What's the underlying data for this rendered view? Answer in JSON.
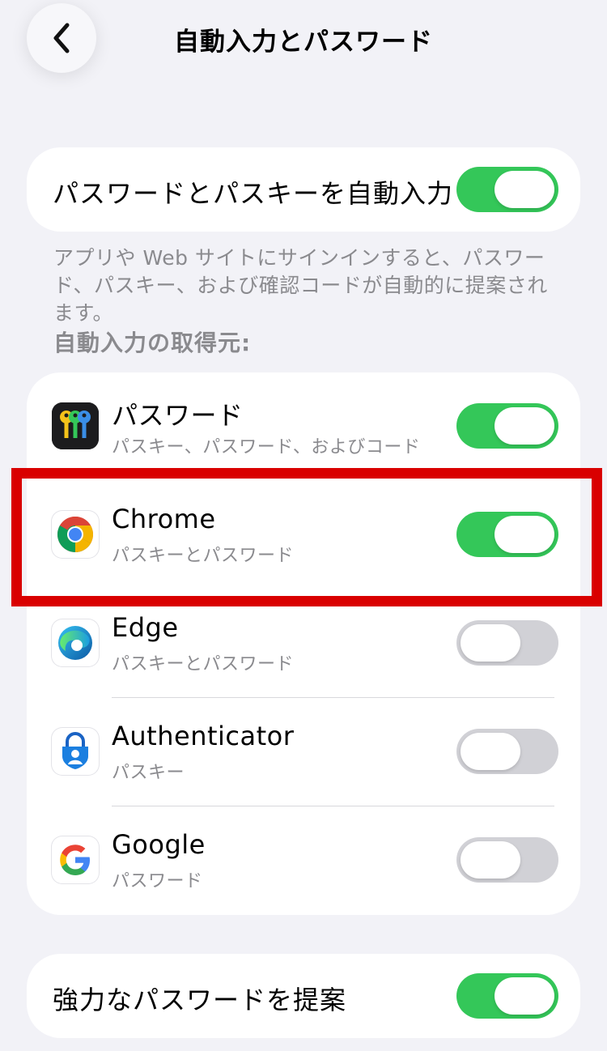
{
  "header": {
    "title": "自動入力とパスワード"
  },
  "autofill_card": {
    "label": "パスワードとパスキーを自動入力",
    "enabled": true
  },
  "footnote": "アプリや Web サイトにサインインすると、パスワード、パスキー、および確認コードが自動的に提案されます。",
  "sources": {
    "header": "自動入力の取得元:",
    "items": [
      {
        "name": "パスワード",
        "subtitle": "パスキー、パスワード、およびコード",
        "enabled": true,
        "icon": "passwords-keys-icon"
      },
      {
        "name": "Chrome",
        "subtitle": "パスキーとパスワード",
        "enabled": true,
        "icon": "chrome-icon"
      },
      {
        "name": "Edge",
        "subtitle": "パスキーとパスワード",
        "enabled": false,
        "icon": "edge-icon"
      },
      {
        "name": "Authenticator",
        "subtitle": "パスキー",
        "enabled": false,
        "icon": "authenticator-icon"
      },
      {
        "name": "Google",
        "subtitle": "パスワード",
        "enabled": false,
        "icon": "google-icon"
      }
    ]
  },
  "strong_password_card": {
    "label": "強力なパスワードを提案",
    "enabled": true
  },
  "colors": {
    "toggle_on": "#34c759",
    "toggle_off": "#d1d1d6",
    "highlight": "#d90000",
    "background": "#f2f2f7"
  }
}
